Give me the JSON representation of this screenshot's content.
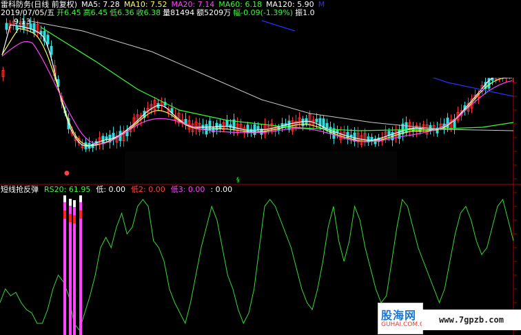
{
  "header": {
    "title": "雷科防务(日线 前复权)",
    "ma5": "MA5: 7.28",
    "ma10": "MA10: 7.52",
    "ma20": "MA20: 7.14",
    "ma60": "MA60: 6.18",
    "ma120": "MA120: 5.90",
    "extra": "M",
    "date": "2019/07/05/五",
    "open": "开6.45",
    "high": "高6.45",
    "low": "低6.36",
    "close": "收6.38",
    "volume": "量81494",
    "amount": "额5209万",
    "change": "幅-0.09(-1.39%)",
    "amplitude": "振1.0"
  },
  "price_label": "9.13",
  "marker_bottom": "§",
  "indicator": {
    "name": "短线抢反弹",
    "rs20": "RS20: 61.95",
    "low": "低: 0.00",
    "low2": "低2: 0.00",
    "low3": "低3: 0.00",
    "extra": ": 0.00"
  },
  "watermark": {
    "logo": "股海网",
    "logo_sub": "GUHAI.COM.CN",
    "url": "www.7gpzb.com"
  },
  "colors": {
    "up": "#ff3333",
    "down": "#33dddd",
    "ma5": "#ffffff",
    "ma10": "#ffff55",
    "ma20": "#ff44ff",
    "ma60": "#33ff33",
    "ma120": "#cccccc",
    "ma250": "#2233ff",
    "rs": "#33dd33",
    "bar": "#ff44ff"
  }
}
